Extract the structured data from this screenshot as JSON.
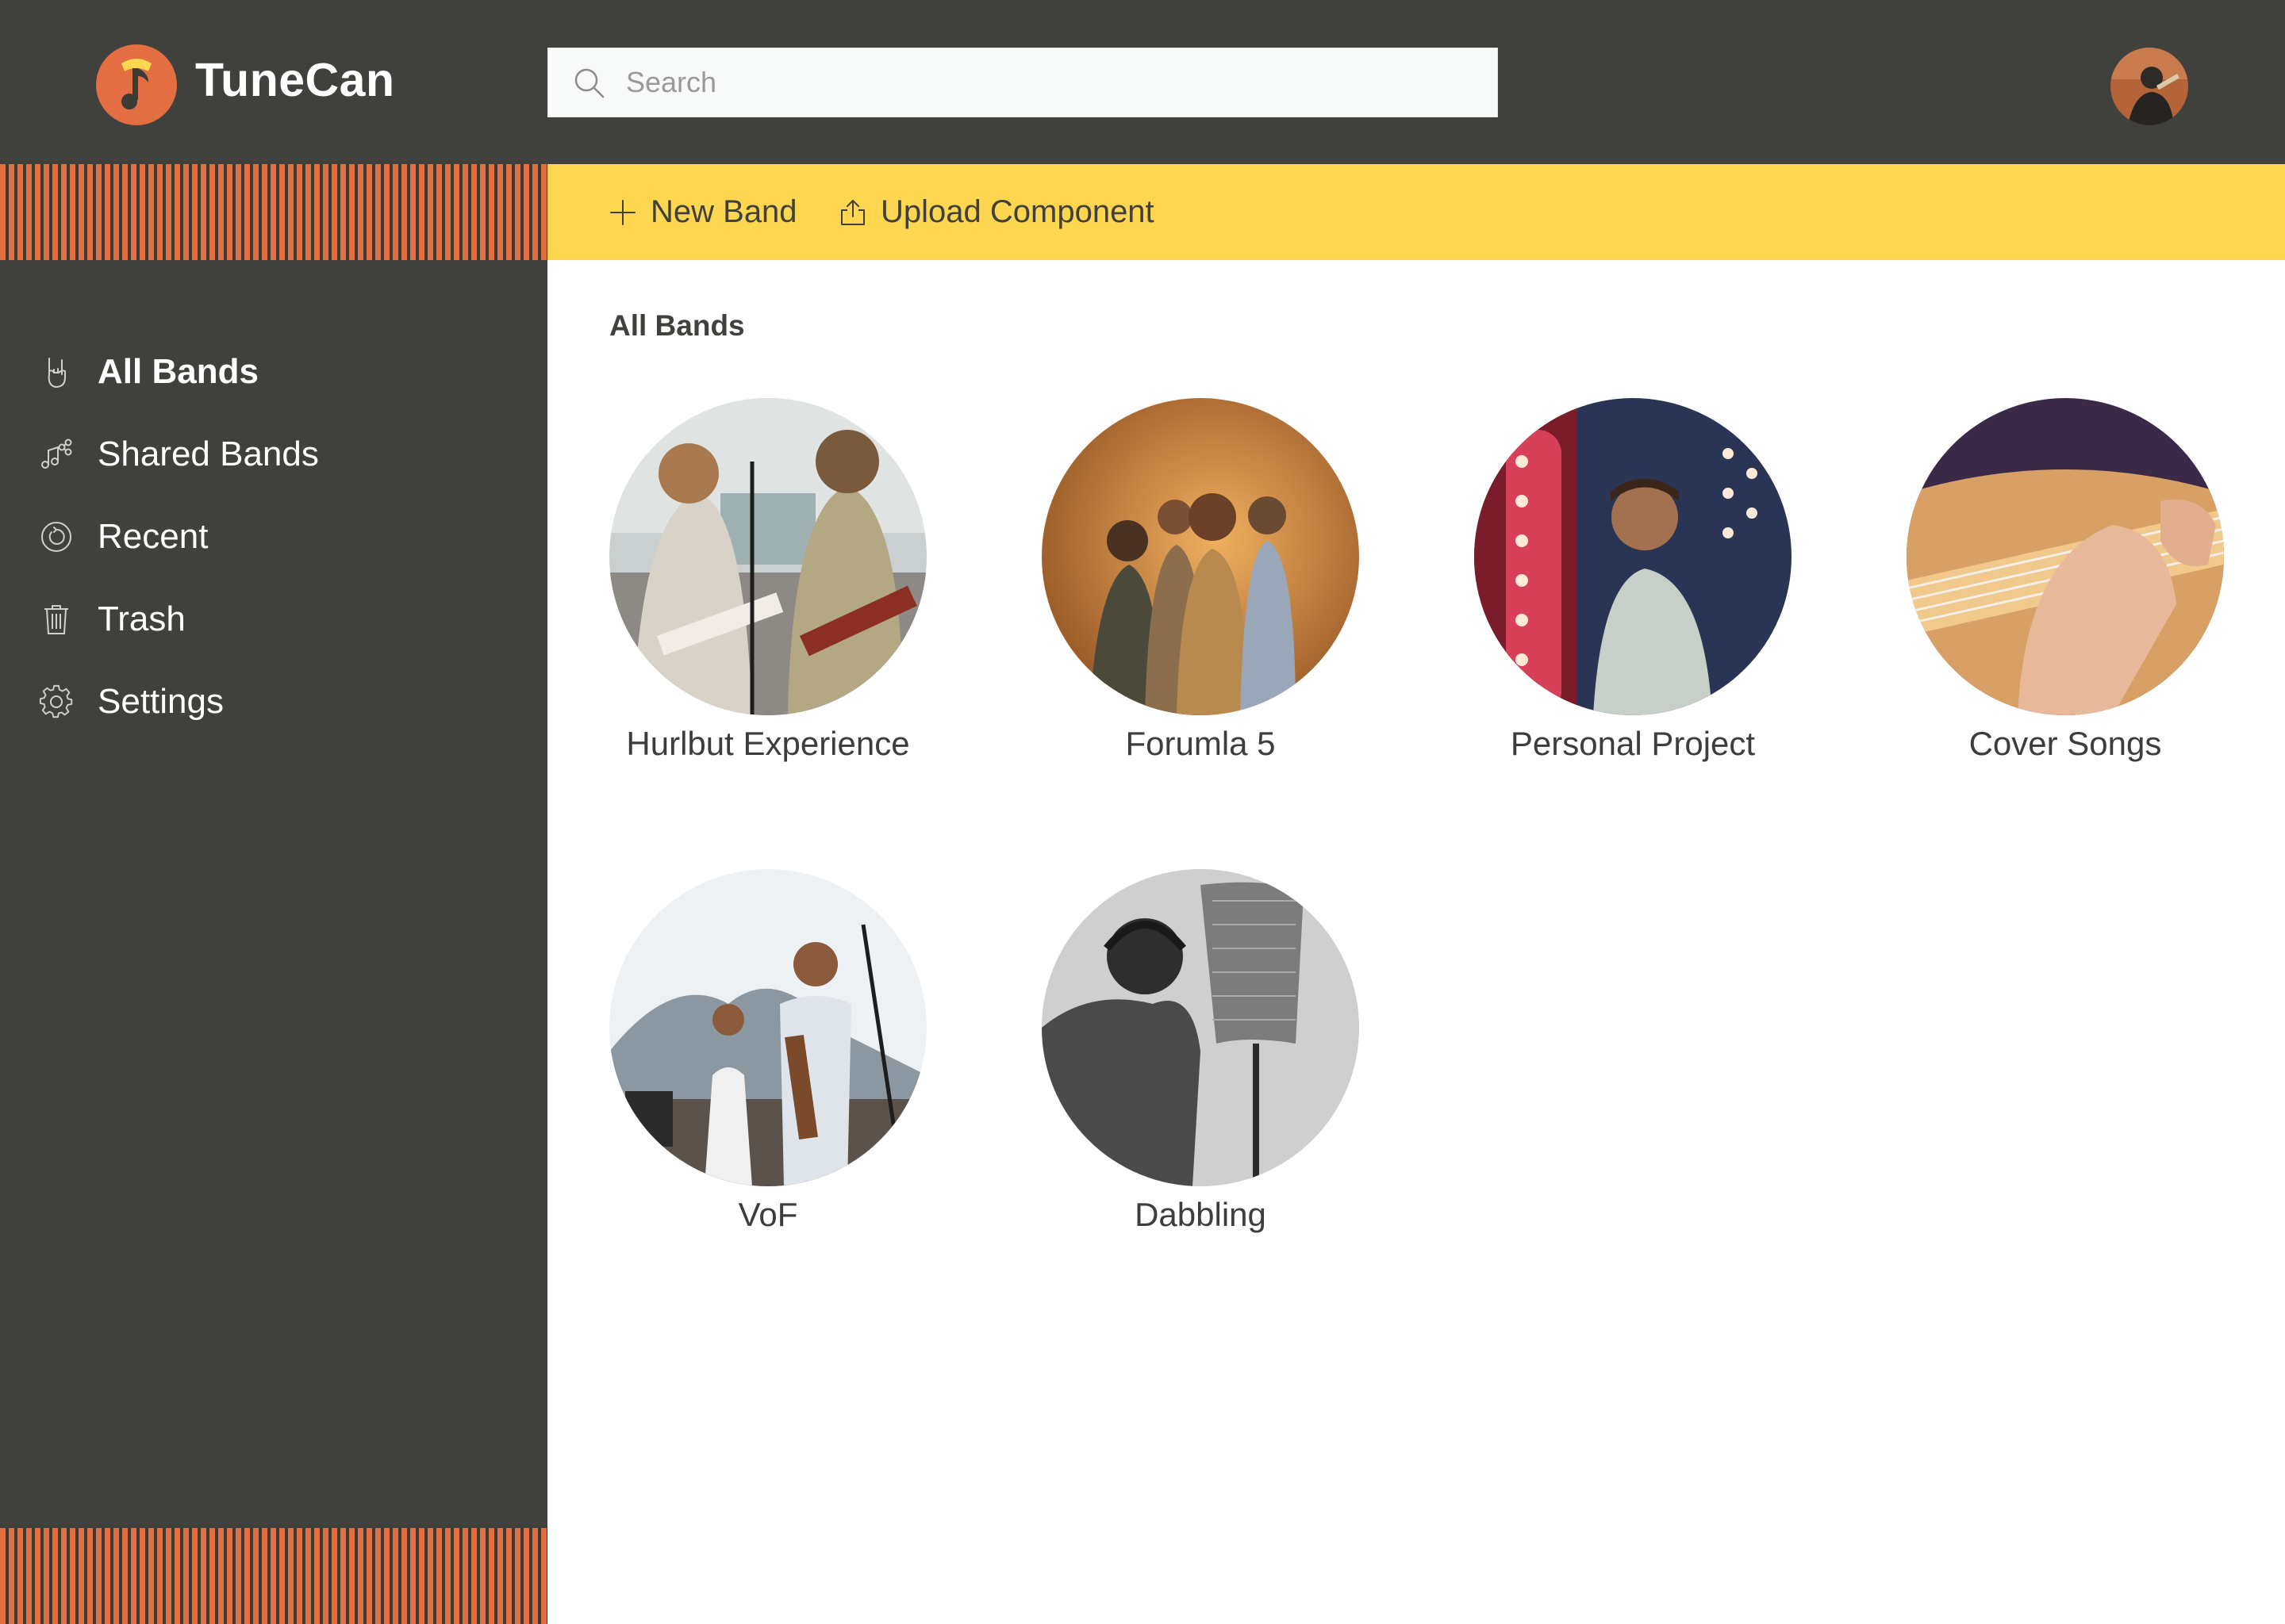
{
  "app": {
    "name": "TuneCan",
    "colors": {
      "dark": "#40403c",
      "accent": "#e26e41",
      "toolbar": "#ffd64f"
    }
  },
  "search": {
    "placeholder": "Search",
    "value": ""
  },
  "sidebar": {
    "items": [
      {
        "label": "All Bands",
        "icon": "rock-hand-icon",
        "active": true
      },
      {
        "label": "Shared Bands",
        "icon": "shared-music-icon",
        "active": false
      },
      {
        "label": "Recent",
        "icon": "clock-icon",
        "active": false
      },
      {
        "label": "Trash",
        "icon": "trash-icon",
        "active": false
      },
      {
        "label": "Settings",
        "icon": "gear-icon",
        "active": false
      }
    ]
  },
  "toolbar": {
    "new_band_label": "New Band",
    "upload_component_label": "Upload Component"
  },
  "main": {
    "section_title": "All Bands",
    "bands": [
      {
        "name": "Hurlbut Experience"
      },
      {
        "name": "Forumla 5"
      },
      {
        "name": "Personal Project"
      },
      {
        "name": "Cover Songs"
      },
      {
        "name": "VoF"
      },
      {
        "name": "Dabbling"
      }
    ]
  }
}
